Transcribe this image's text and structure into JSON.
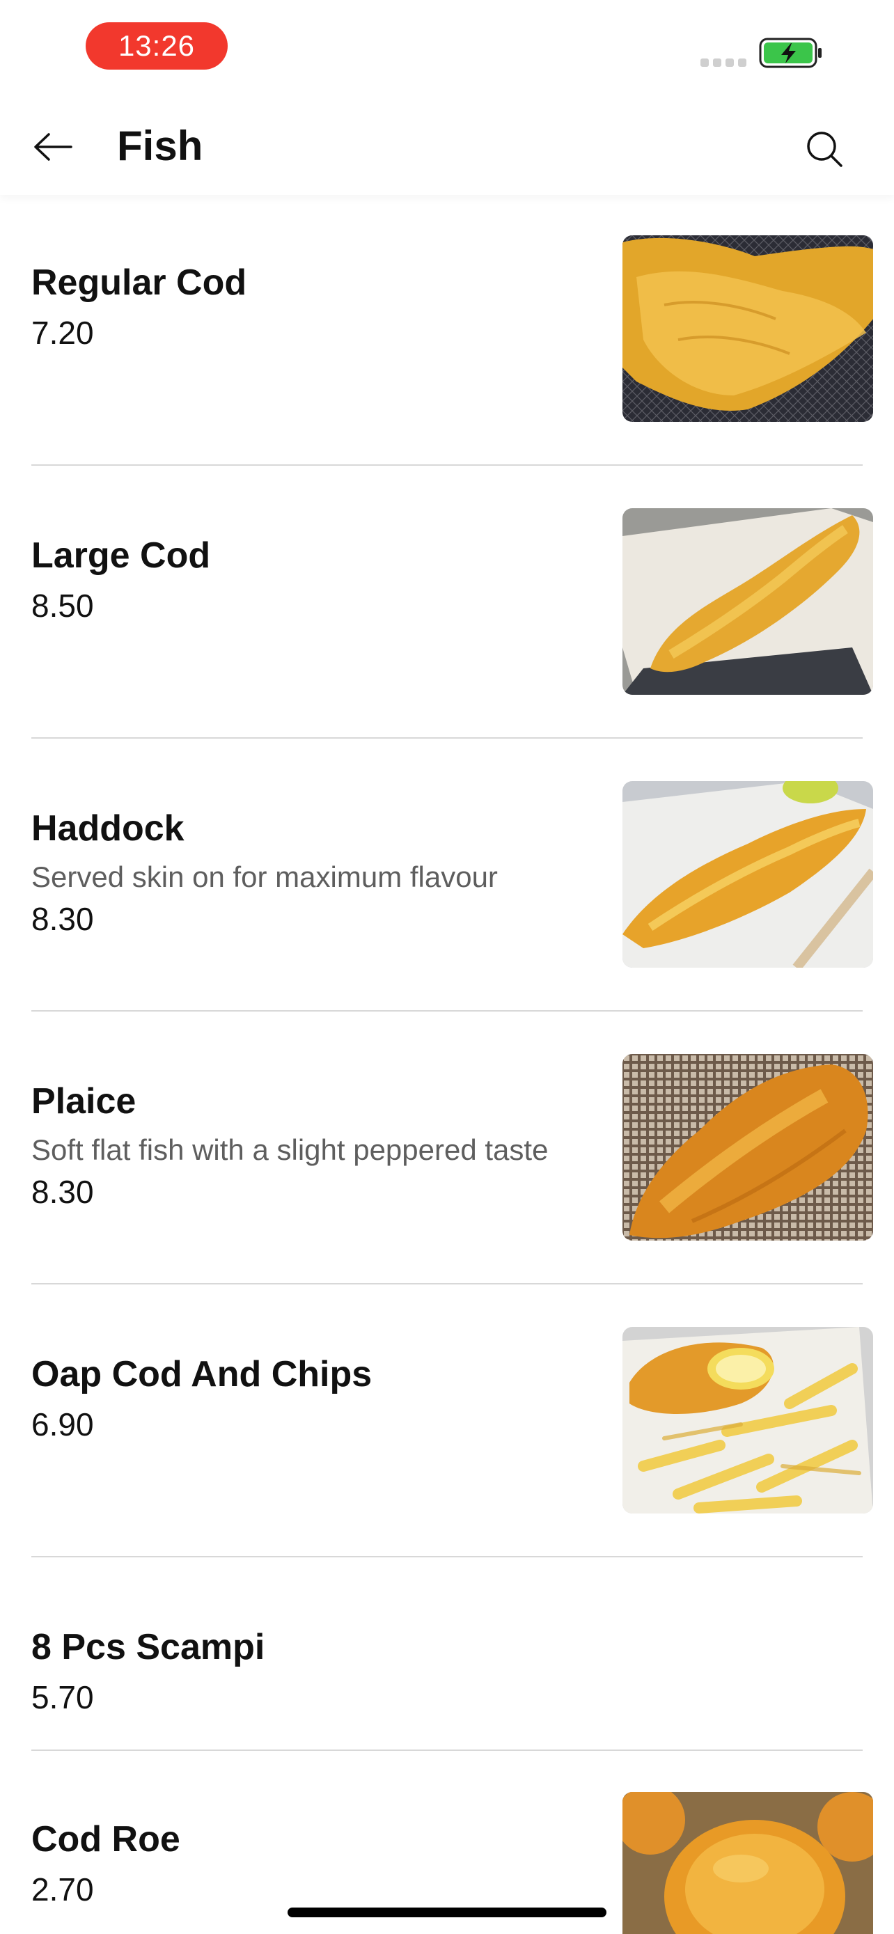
{
  "status_bar": {
    "time": "13:26",
    "time_pill_color": "#f2382d",
    "battery_color": "#3bc54a",
    "battery_state": "charging"
  },
  "header": {
    "title": "Fish",
    "back_icon": "arrow-left-icon",
    "search_icon": "search-icon"
  },
  "items": [
    {
      "name": "Regular Cod",
      "description": "",
      "price": "7.20",
      "photo": "battered cod on wire rack"
    },
    {
      "name": "Large Cod",
      "description": "",
      "price": "8.50",
      "photo": "large battered cod in box"
    },
    {
      "name": "Haddock",
      "description": "Served skin on for maximum flavour",
      "price": "8.30",
      "photo": "battered haddock with lemon"
    },
    {
      "name": "Plaice",
      "description": "Soft flat fish with a slight peppered taste",
      "price": "8.30",
      "photo": "battered plaice on mesh"
    },
    {
      "name": "Oap Cod And Chips",
      "description": "",
      "price": "6.90",
      "photo": "cod and chips with lemon"
    },
    {
      "name": "8 Pcs Scampi",
      "description": "",
      "price": "5.70",
      "photo": ""
    },
    {
      "name": "Cod Roe",
      "description": "",
      "price": "2.70",
      "photo": "fried cod roe"
    }
  ]
}
